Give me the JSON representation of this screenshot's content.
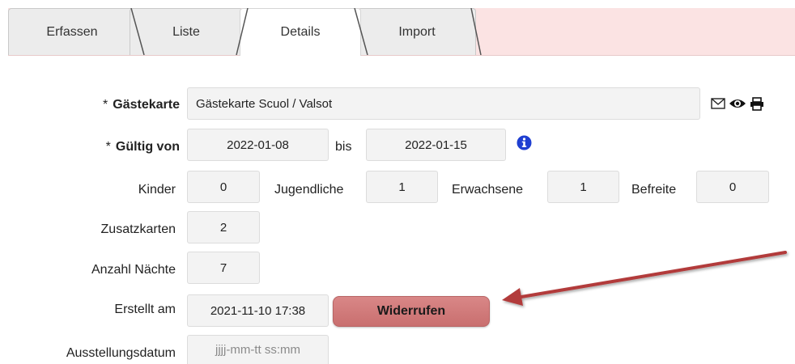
{
  "tabs": [
    {
      "label": "Erfassen",
      "active": false
    },
    {
      "label": "Liste",
      "active": false
    },
    {
      "label": "Details",
      "active": true
    },
    {
      "label": "Import",
      "active": false
    }
  ],
  "form": {
    "required_marker": "*",
    "guest_card": {
      "label": "Gästekarte",
      "value": "Gästekarte Scuol / Valsot"
    },
    "valid": {
      "label": "Gültig von",
      "from": "2022-01-08",
      "to_label": "bis",
      "to": "2022-01-15"
    },
    "kinder": {
      "label": "Kinder",
      "value": "0"
    },
    "jugendliche": {
      "label": "Jugendliche",
      "value": "1"
    },
    "erwachsene": {
      "label": "Erwachsene",
      "value": "1"
    },
    "befreite": {
      "label": "Befreite",
      "value": "0"
    },
    "zusatzkarten": {
      "label": "Zusatzkarten",
      "value": "2"
    },
    "naechte": {
      "label": "Anzahl Nächte",
      "value": "7"
    },
    "erstellt": {
      "label": "Erstellt am",
      "value": "2021-11-10 17:38",
      "button_label": "Widerrufen"
    },
    "ausstellung": {
      "label": "Ausstellungsdatum",
      "placeholder": "jjjj-mm-tt ss:mm"
    }
  },
  "icons": {
    "card_actions": [
      "envelope-icon",
      "eye-icon",
      "print-icon"
    ],
    "info": "info-icon"
  },
  "colors": {
    "tab_bar_bg": "#fbe3e3",
    "revoke_button": "#d07a7a",
    "arrow": "#b23a3a",
    "info_icon": "#1f3fd1"
  }
}
